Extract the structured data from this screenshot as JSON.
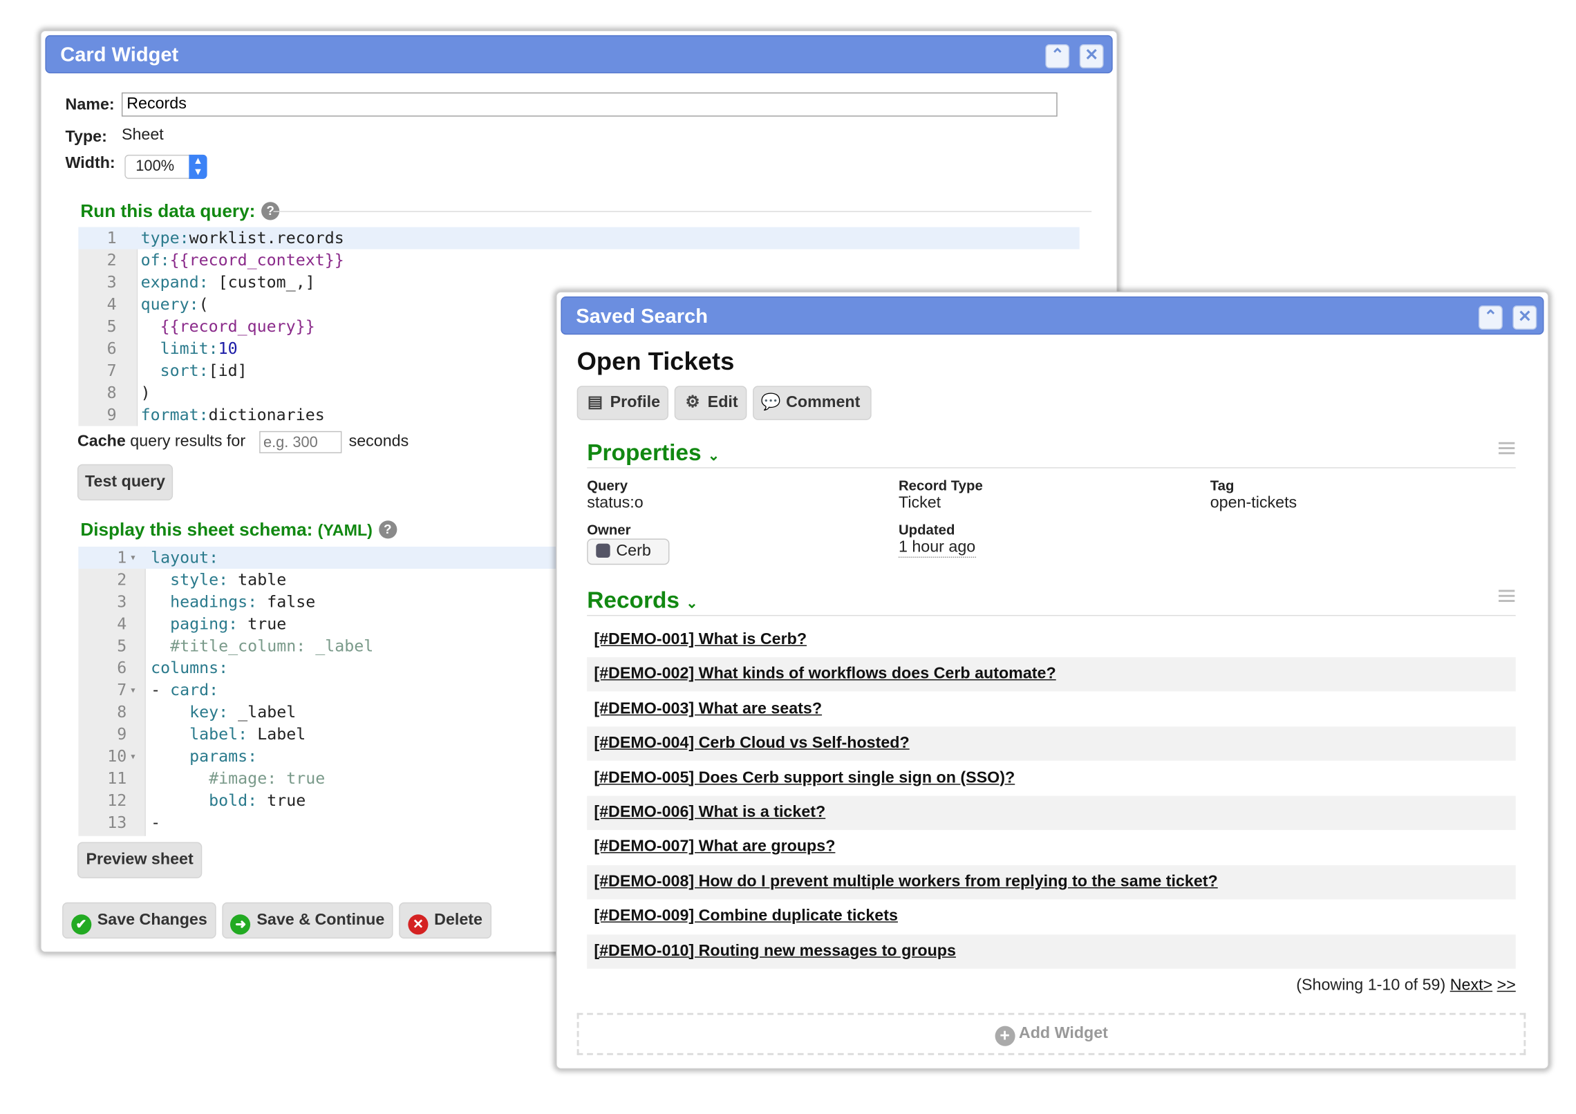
{
  "card_widget": {
    "title": "Card Widget",
    "name_label": "Name:",
    "name_value": "Records",
    "type_label": "Type:",
    "type_value": "Sheet",
    "width_label": "Width:",
    "width_value": "100%",
    "query_heading": "Run this data query:",
    "query_lines": [
      [
        "type:",
        "worklist.records"
      ],
      [
        "of:",
        "{{record_context}}"
      ],
      [
        "expand:",
        " [custom_,]"
      ],
      [
        "query:",
        "("
      ],
      [
        "  {{record_query}}",
        ""
      ],
      [
        "  limit:",
        "10"
      ],
      [
        "  sort:",
        "[id]"
      ],
      [
        ")",
        ""
      ],
      [
        "format:",
        "dictionaries"
      ]
    ],
    "cache_label_bold": "Cache",
    "cache_label_rest": " query results for",
    "cache_placeholder": "e.g. 300",
    "cache_unit": "seconds",
    "test_query_button": "Test query",
    "schema_heading": "Display this sheet schema:",
    "schema_heading_suffix": "(YAML)",
    "schema_lines": [
      [
        "layout:",
        ""
      ],
      [
        "  style:",
        " table"
      ],
      [
        "  headings:",
        " false"
      ],
      [
        "  paging:",
        " true"
      ],
      [
        "  #title_column: _label",
        ""
      ],
      [
        "columns:",
        ""
      ],
      [
        "- card:",
        ""
      ],
      [
        "    key:",
        " _label"
      ],
      [
        "    label:",
        " Label"
      ],
      [
        "    params:",
        ""
      ],
      [
        "      #image: true",
        ""
      ],
      [
        "      bold:",
        " true"
      ],
      [
        "-",
        ""
      ]
    ],
    "preview_button": "Preview sheet",
    "save_button": "Save Changes",
    "save_continue_button": "Save & Continue",
    "delete_button": "Delete"
  },
  "saved_search": {
    "title": "Saved Search",
    "heading": "Open Tickets",
    "toolbar": {
      "profile": "Profile",
      "edit": "Edit",
      "comment": "Comment"
    },
    "properties_heading": "Properties",
    "properties": {
      "query_label": "Query",
      "query_value": "status:o",
      "record_type_label": "Record Type",
      "record_type_value": "Ticket",
      "tag_label": "Tag",
      "tag_value": "open-tickets",
      "owner_label": "Owner",
      "owner_value": "Cerb",
      "updated_label": "Updated",
      "updated_value": "1 hour ago"
    },
    "records_heading": "Records",
    "records": [
      "[#DEMO-001] What is Cerb?",
      "[#DEMO-002] What kinds of workflows does Cerb automate?",
      "[#DEMO-003] What are seats?",
      "[#DEMO-004] Cerb Cloud vs Self-hosted?",
      "[#DEMO-005] Does Cerb support single sign on (SSO)?",
      "[#DEMO-006] What is a ticket?",
      "[#DEMO-007] What are groups?",
      "[#DEMO-008] How do I prevent multiple workers from replying to the same ticket?",
      "[#DEMO-009] Combine duplicate tickets",
      "[#DEMO-010] Routing new messages to groups"
    ],
    "paging_text": "(Showing 1-10 of 59)",
    "next_link": "Next>",
    "last_link": ">>",
    "add_widget": "Add Widget"
  },
  "colors": {
    "title_bar": "#6b8ee0",
    "section_heading": "#118811",
    "save_icon": "#22aa22",
    "delete_icon": "#d42222"
  }
}
